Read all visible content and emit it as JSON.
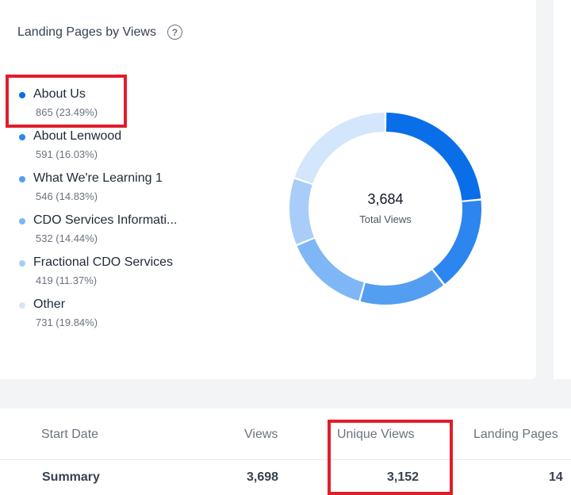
{
  "card": {
    "title": "Landing Pages by Views",
    "help_icon": "question-circle-icon"
  },
  "legend": [
    {
      "label": "About Us",
      "value": "865 (23.49%)",
      "color": "#0a6ee8"
    },
    {
      "label": "About Lenwood",
      "value": "591 (16.03%)",
      "color": "#2d85ef"
    },
    {
      "label": "What We're Learning 1",
      "value": "546 (14.83%)",
      "color": "#549ef2"
    },
    {
      "label": "CDO Services Informati...",
      "value": "532 (14.44%)",
      "color": "#7fb6f5"
    },
    {
      "label": "Fractional CDO Services",
      "value": "419 (11.37%)",
      "color": "#a9cdf8"
    },
    {
      "label": "Other",
      "value": "731 (19.84%)",
      "color": "#d4e6fb"
    }
  ],
  "donut": {
    "total_value": "3,684",
    "total_label": "Total Views"
  },
  "chart_data": {
    "type": "pie",
    "categories": [
      "About Us",
      "About Lenwood",
      "What We're Learning 1",
      "CDO Services Informati...",
      "Fractional CDO Services",
      "Other"
    ],
    "values": [
      865,
      591,
      546,
      532,
      419,
      731
    ],
    "colors": [
      "#0a6ee8",
      "#2d85ef",
      "#549ef2",
      "#7fb6f5",
      "#a9cdf8",
      "#d4e6fb"
    ],
    "title": "Landing Pages by Views"
  },
  "table": {
    "headers": {
      "start_date": "Start Date",
      "views": "Views",
      "unique_views": "Unique Views",
      "landing_pages": "Landing Pages"
    },
    "summary": {
      "label": "Summary",
      "views": "3,698",
      "unique_views": "3,152",
      "landing_pages": "14"
    }
  },
  "colors": {
    "highlight": "#e11d2a",
    "background": "#f3f4f6"
  }
}
